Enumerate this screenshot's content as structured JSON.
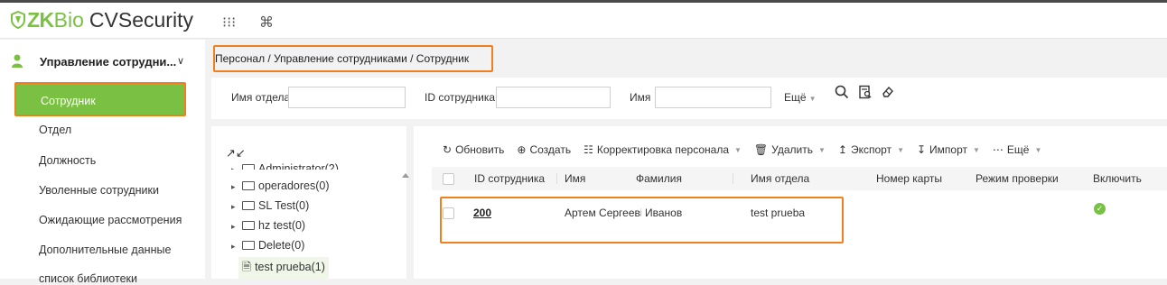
{
  "app": {
    "logo_zk": "ZK",
    "logo_bio": "Bio",
    "logo_cvsecurity": "CVSecurity",
    "header_icons": [
      "grid-icon",
      "command-icon"
    ],
    "grid_glyph": "⁝⁝⁝",
    "command_glyph": "⌘",
    "brand_color": "#7ac143",
    "highlight_color": "#f0801e"
  },
  "sidebar": {
    "section_title": "Управление сотрудни...",
    "items": [
      {
        "label": "Сотрудник",
        "active": true
      },
      {
        "label": "Отдел"
      },
      {
        "label": "Должность"
      },
      {
        "label": "Уволенные сотрудники"
      },
      {
        "label": "Ожидающие рассмотрения"
      },
      {
        "label": "Дополнительные данные"
      },
      {
        "label": "список библиотеки"
      }
    ]
  },
  "breadcrumb": "Персонал / Управление сотрудниками / Сотрудник",
  "filters": {
    "dept_label": "Имя отдела",
    "dept_value": "",
    "id_label": "ID сотрудника",
    "id_value": "",
    "name_label": "Имя",
    "name_value": "",
    "more_label": "Ещё"
  },
  "tree": {
    "partial_top": "Administrator(2)",
    "items": [
      {
        "label": "operadores(0)"
      },
      {
        "label": "SL Test(0)"
      },
      {
        "label": "hz test(0)"
      },
      {
        "label": "Delete(0)"
      },
      {
        "label": "test prueba(1)",
        "selected": true
      }
    ]
  },
  "toolbar": {
    "refresh": "Обновить",
    "create": "Создать",
    "adjust": "Корректировка персонала",
    "delete": "Удалить",
    "export": "Экспорт",
    "import": "Импорт",
    "more": "Ещё"
  },
  "table": {
    "columns": [
      "ID сотрудника",
      "Имя",
      "Фамилия",
      "Имя отдела",
      "Номер карты",
      "Режим проверки",
      "Включить"
    ],
    "rows": [
      {
        "id": "200",
        "first_name": "Артем Сергееві",
        "last_name": "Иванов",
        "dept": "test prueba",
        "card": "",
        "verify_mode": "",
        "enabled": true
      }
    ]
  }
}
